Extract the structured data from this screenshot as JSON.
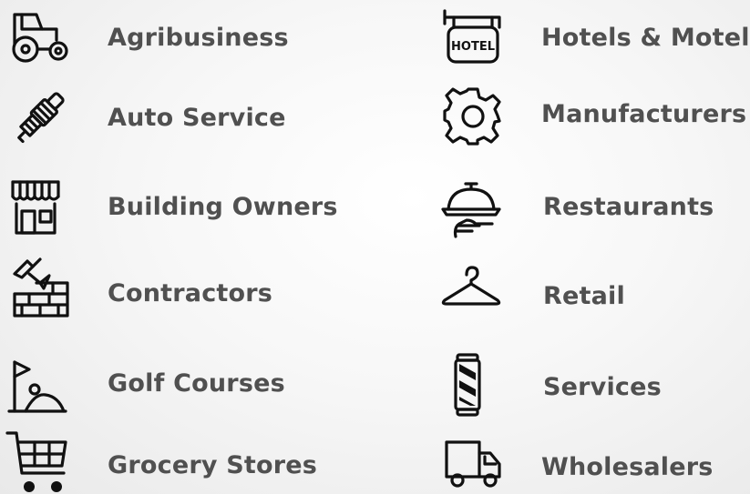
{
  "industries": {
    "left": [
      {
        "label": "Agribusiness",
        "icon": "tractor-icon"
      },
      {
        "label": "Auto Service",
        "icon": "spark-plug-icon"
      },
      {
        "label": "Building Owners",
        "icon": "storefront-icon"
      },
      {
        "label": "Contractors",
        "icon": "trowel-bricks-icon"
      },
      {
        "label": "Golf Courses",
        "icon": "golf-flag-icon"
      },
      {
        "label": "Grocery Stores",
        "icon": "shopping-cart-icon"
      }
    ],
    "right": [
      {
        "label": "Hotels & Motels",
        "icon": "hotel-sign-icon",
        "sign_text": "HOTEL"
      },
      {
        "label": "Manufacturers",
        "icon": "gear-icon"
      },
      {
        "label": "Restaurants",
        "icon": "cloche-icon"
      },
      {
        "label": "Retail",
        "icon": "hanger-icon"
      },
      {
        "label": "Services",
        "icon": "barber-pole-icon"
      },
      {
        "label": "Wholesalers",
        "icon": "delivery-truck-icon"
      }
    ]
  }
}
